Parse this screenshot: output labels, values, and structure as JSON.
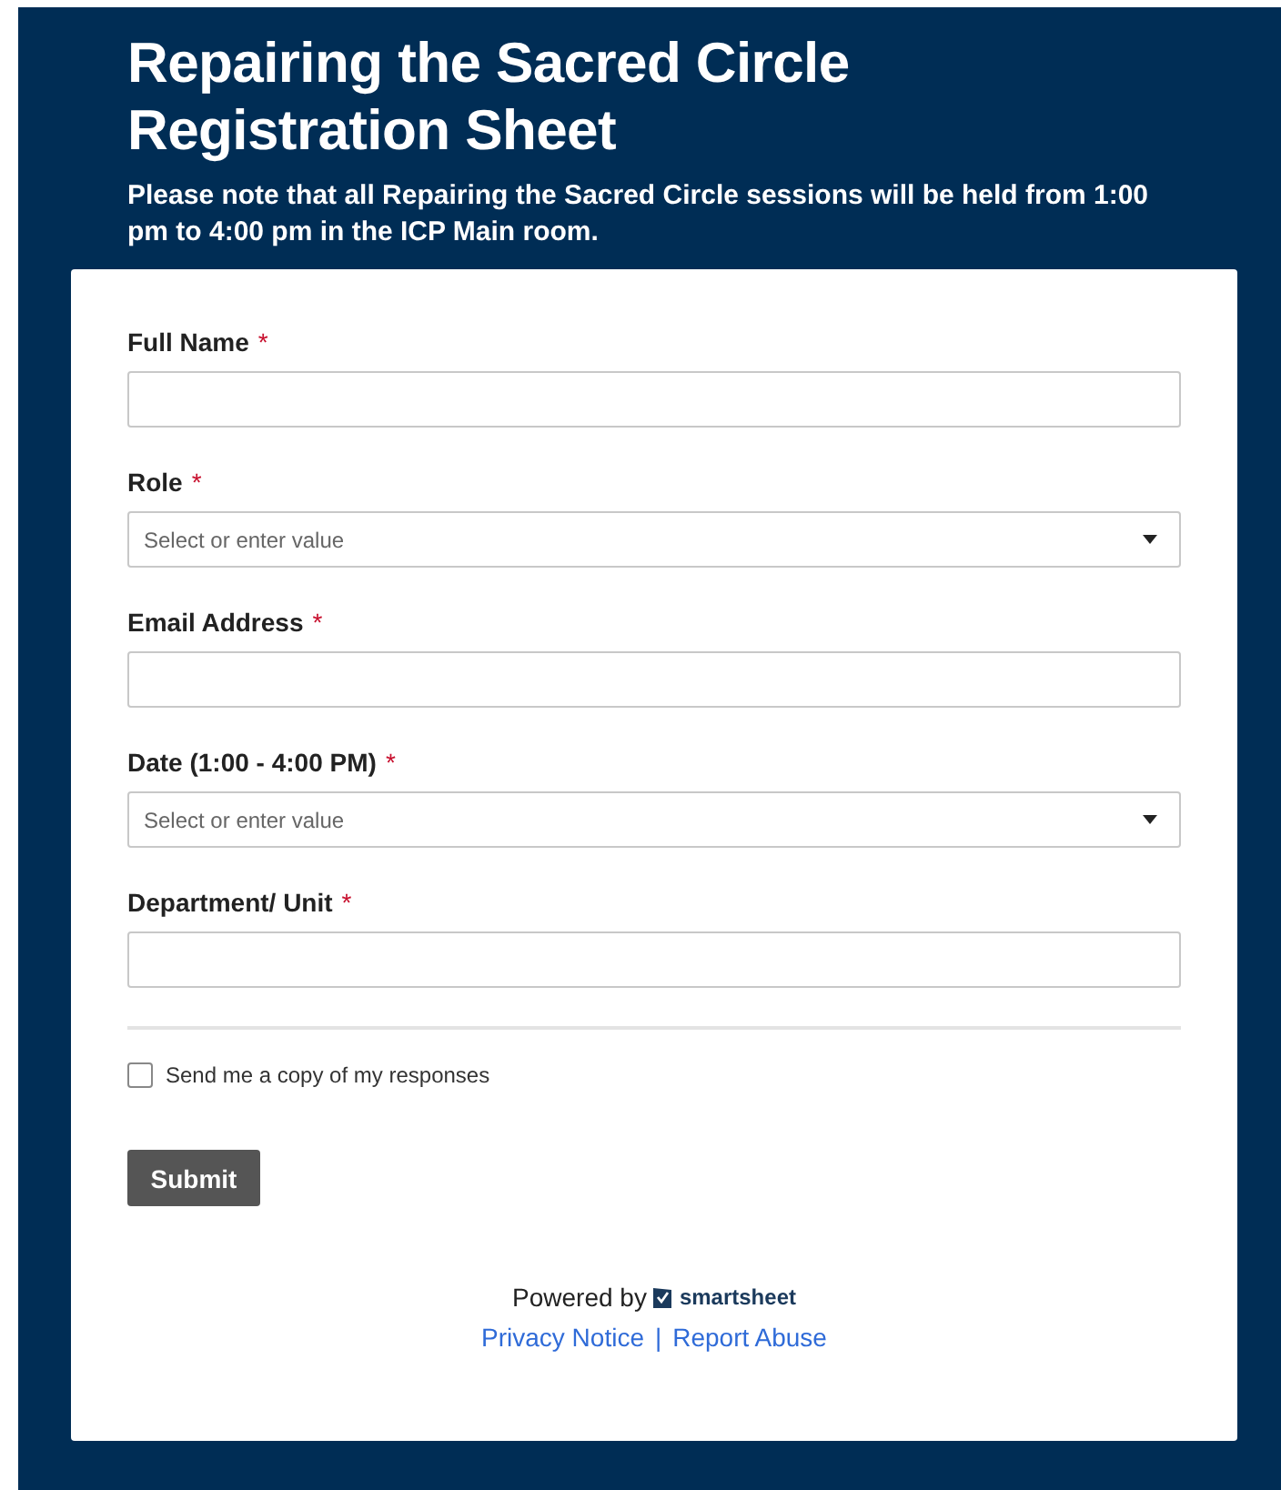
{
  "header": {
    "title": "Repairing the Sacred Circle Registration Sheet",
    "note": "Please note that all Repairing the Sacred Circle sessions will be held from 1:00 pm to 4:00 pm in the ICP Main room."
  },
  "fields": [
    {
      "kind": "text",
      "label": "Full Name",
      "required_mark": "*"
    },
    {
      "kind": "select",
      "label": "Role",
      "required_mark": "*",
      "placeholder": "Select or enter value"
    },
    {
      "kind": "text",
      "label": "Email Address",
      "required_mark": "*"
    },
    {
      "kind": "select",
      "label": "Date (1:00 - 4:00 PM)",
      "required_mark": "*",
      "placeholder": "Select or enter value"
    },
    {
      "kind": "text",
      "label": "Department/ Unit",
      "required_mark": "*"
    }
  ],
  "copy_option": {
    "label": "Send me a copy of my responses",
    "checked": false
  },
  "submit": "Submit",
  "footer": {
    "powered_by": "Powered by",
    "brand": "smartsheet",
    "links": [
      "Privacy Notice",
      "Report Abuse"
    ],
    "separator": "|"
  }
}
